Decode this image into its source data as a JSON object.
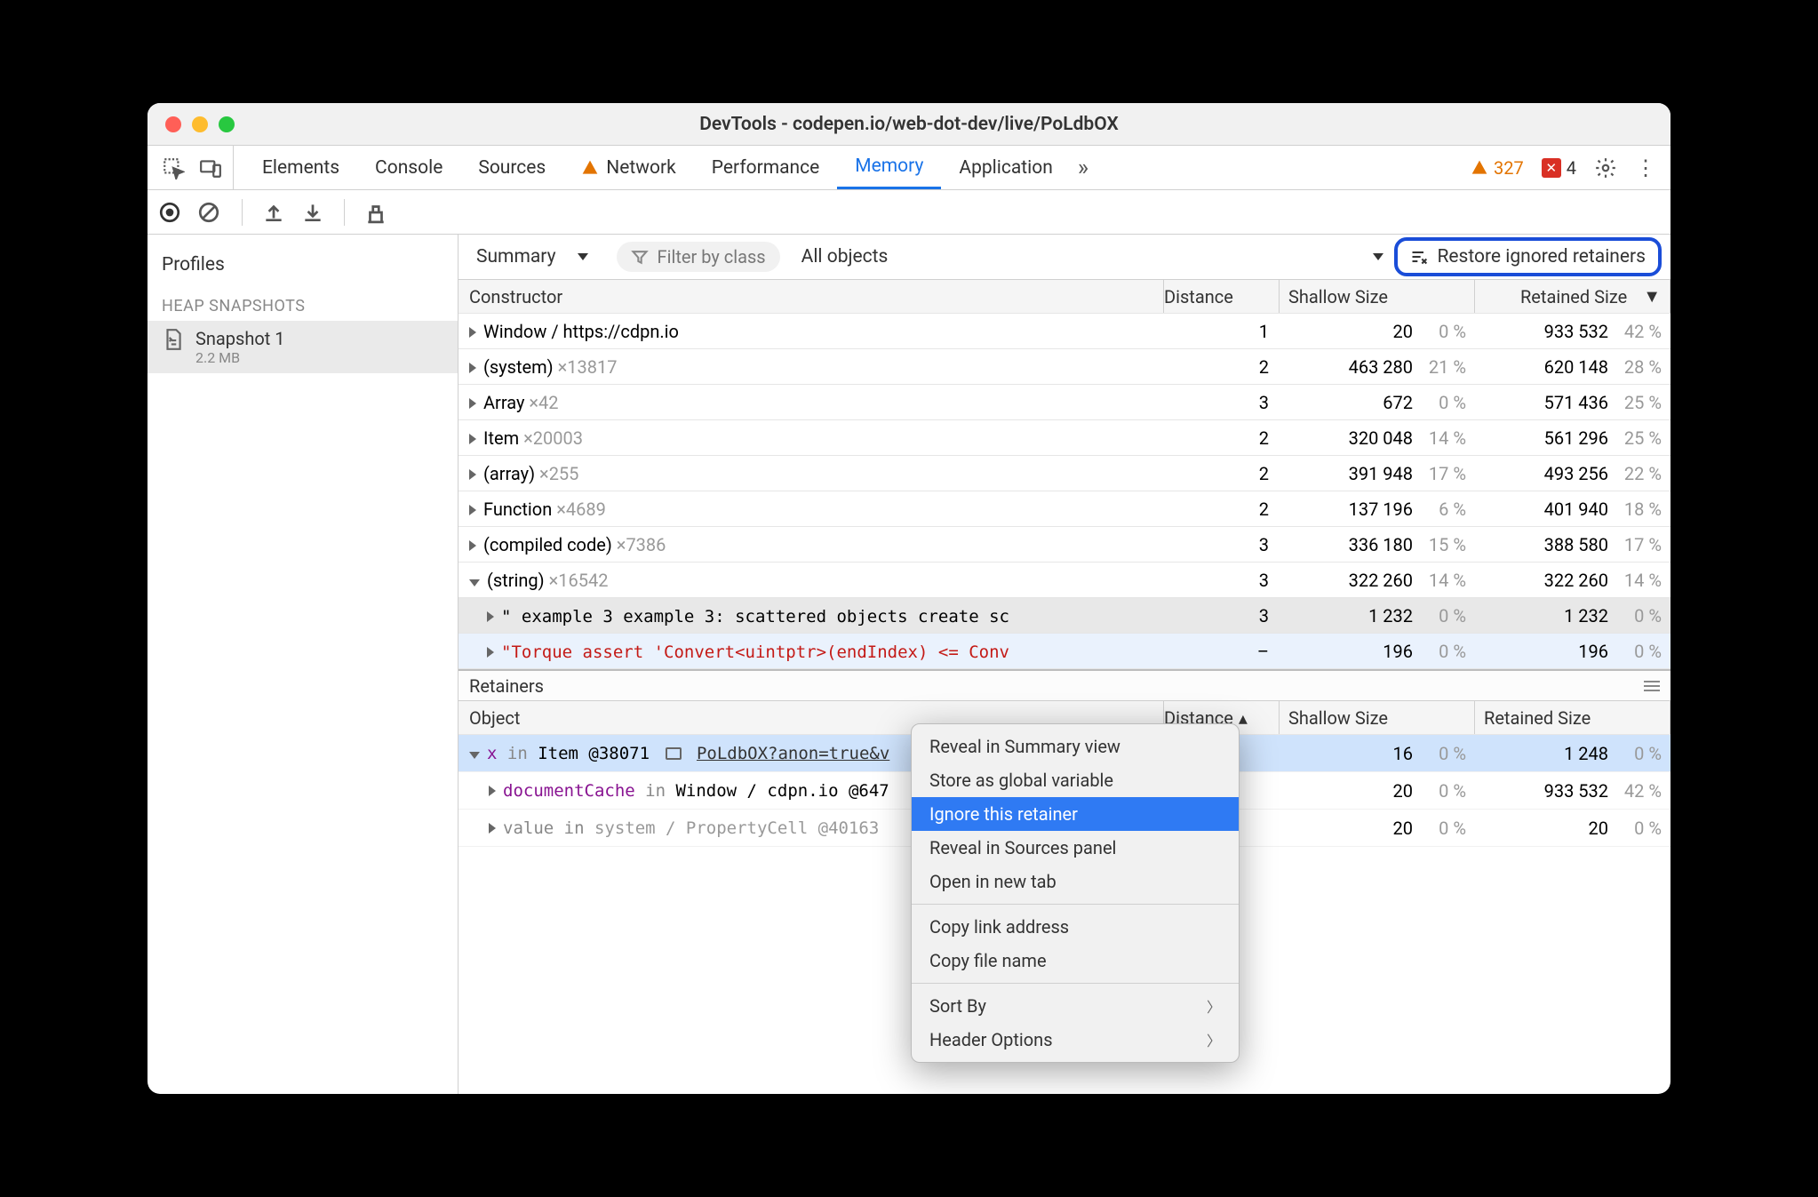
{
  "titlebar": {
    "title": "DevTools - codepen.io/web-dot-dev/live/PoLdbOX"
  },
  "tabs": [
    "Elements",
    "Console",
    "Sources",
    "Network",
    "Performance",
    "Memory",
    "Application"
  ],
  "active_tab": "Memory",
  "counts": {
    "warnings": "327",
    "errors": "4"
  },
  "sidebar": {
    "heading": "Profiles",
    "sub": "HEAP SNAPSHOTS",
    "snapshot": {
      "name": "Snapshot 1",
      "size": "2.2 MB"
    }
  },
  "content_toolbar": {
    "summary": "Summary",
    "filter_placeholder": "Filter by class",
    "all_objects": "All objects",
    "restore": "Restore ignored retainers"
  },
  "grid": {
    "headers": [
      "Constructor",
      "Distance",
      "Shallow Size",
      "Retained Size"
    ],
    "rows": [
      {
        "c": "Window / https://cdpn.io",
        "cnt": "",
        "d": "1",
        "s": "20",
        "sp": "0 %",
        "r": "933 532",
        "rp": "42 %"
      },
      {
        "c": "(system)",
        "cnt": "×13817",
        "d": "2",
        "s": "463 280",
        "sp": "21 %",
        "r": "620 148",
        "rp": "28 %"
      },
      {
        "c": "Array",
        "cnt": "×42",
        "d": "3",
        "s": "672",
        "sp": "0 %",
        "r": "571 436",
        "rp": "25 %"
      },
      {
        "c": "Item",
        "cnt": "×20003",
        "d": "2",
        "s": "320 048",
        "sp": "14 %",
        "r": "561 296",
        "rp": "25 %"
      },
      {
        "c": "(array)",
        "cnt": "×255",
        "d": "2",
        "s": "391 948",
        "sp": "17 %",
        "r": "493 256",
        "rp": "22 %"
      },
      {
        "c": "Function",
        "cnt": "×4689",
        "d": "2",
        "s": "137 196",
        "sp": "6 %",
        "r": "401 940",
        "rp": "18 %"
      },
      {
        "c": "(compiled code)",
        "cnt": "×7386",
        "d": "3",
        "s": "336 180",
        "sp": "15 %",
        "r": "388 580",
        "rp": "17 %"
      },
      {
        "c": "(string)",
        "cnt": "×16542",
        "d": "3",
        "s": "322 260",
        "sp": "14 %",
        "r": "322 260",
        "rp": "14 %",
        "open": true
      }
    ],
    "child1": {
      "text": "\" example 3 example 3: scattered objects create sc",
      "d": "3",
      "s": "1 232",
      "sp": "0 %",
      "r": "1 232",
      "rp": "0 %"
    },
    "child2": {
      "text": "\"Torque assert 'Convert<uintptr>(endIndex) <= Conv",
      "d": "–",
      "s": "196",
      "sp": "0 %",
      "r": "196",
      "rp": "0 %"
    }
  },
  "retainers": {
    "title": "Retainers",
    "headers": [
      "Object",
      "Distance",
      "Shallow Size",
      "Retained Size"
    ],
    "rows": [
      {
        "open": true,
        "pre": "x",
        "mid": " in ",
        "item": "Item @38071",
        "link": "PoLdbOX?anon=true&v",
        "d": "",
        "s": "16",
        "sp": "0 %",
        "r": "1 248",
        "rp": "0 %",
        "hl": true
      },
      {
        "open": false,
        "pre": "documentCache",
        "mid": " in ",
        "item": "Window / cdpn.io @647",
        "link": "",
        "d": "",
        "s": "20",
        "sp": "0 %",
        "r": "933 532",
        "rp": "42 %"
      },
      {
        "open": false,
        "pre": "value",
        "mid": " in ",
        "item": "system / PropertyCell @40163",
        "link": "",
        "d": "",
        "s": "20",
        "sp": "0 %",
        "r": "20",
        "rp": "0 %",
        "gray": true
      }
    ]
  },
  "ctx": {
    "items1": [
      "Reveal in Summary view",
      "Store as global variable",
      "Ignore this retainer",
      "Reveal in Sources panel",
      "Open in new tab"
    ],
    "items2": [
      "Copy link address",
      "Copy file name"
    ],
    "items3": [
      "Sort By",
      "Header Options"
    ],
    "highlighted": "Ignore this retainer"
  }
}
